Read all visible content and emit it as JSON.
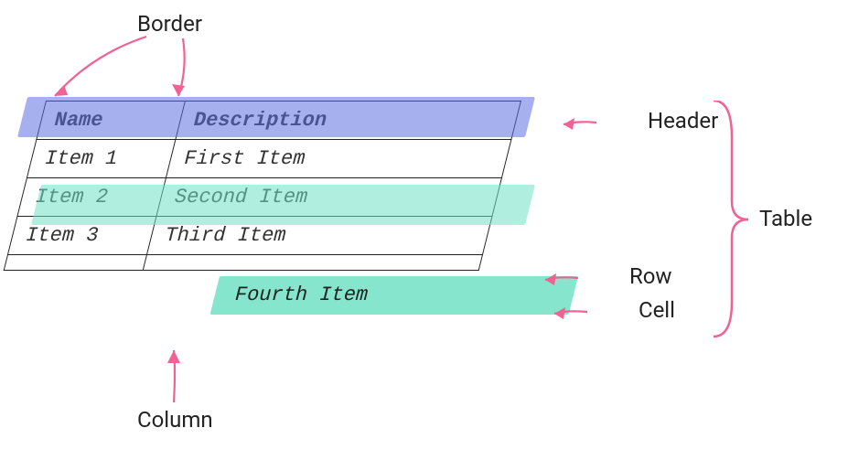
{
  "labels": {
    "border": "Border",
    "header": "Header",
    "row": "Row",
    "cell": "Cell",
    "column": "Column",
    "table": "Table"
  },
  "table": {
    "columns": {
      "name": "Name",
      "description": "Description"
    },
    "rows": [
      {
        "name": "Item 1",
        "description": "First Item"
      },
      {
        "name": "Item 2",
        "description": "Second Item"
      },
      {
        "name": "Item 3",
        "description": "Third Item"
      },
      {
        "name": "",
        "description": ""
      }
    ]
  },
  "lifted_cell_text": "Fourth Item",
  "colors": {
    "header_highlight": "#7d8ae6",
    "row_highlight": "#70e0c4",
    "arrow": "#f06292"
  }
}
